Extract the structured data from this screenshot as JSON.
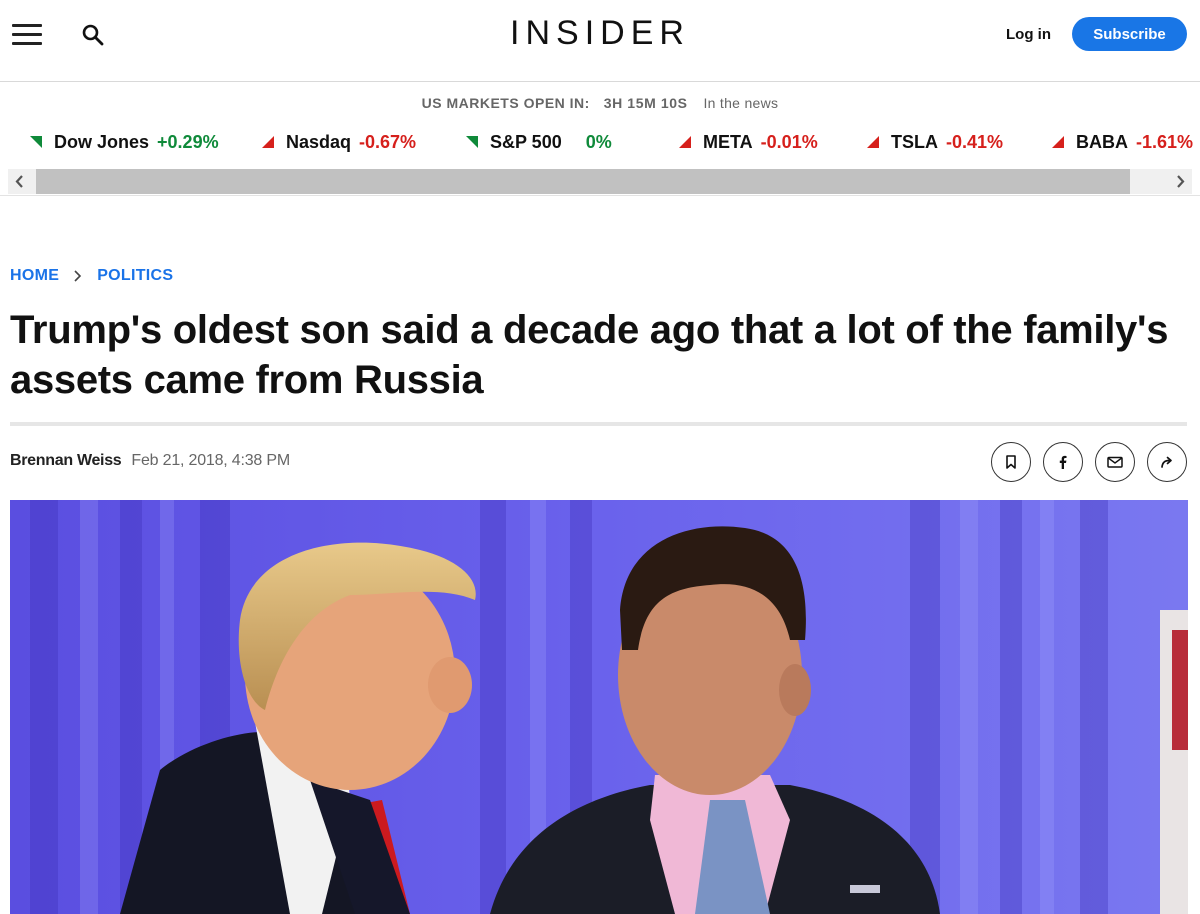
{
  "header": {
    "logo_text": "INSIDER",
    "login_label": "Log in",
    "subscribe_label": "Subscribe",
    "accent_color": "#1976e6"
  },
  "markets": {
    "status_label": "US MARKETS OPEN IN:",
    "countdown": "3H 15M 10S",
    "news_label": "In the news",
    "tickers": [
      {
        "name": "Dow Jones",
        "change": "+0.29%",
        "direction": "up-green"
      },
      {
        "name": "Nasdaq",
        "change": "-0.67%",
        "direction": "down-red"
      },
      {
        "name": "S&P 500",
        "change": "0%",
        "direction": "up-green"
      },
      {
        "name": "META",
        "change": "-0.01%",
        "direction": "down-red"
      },
      {
        "name": "TSLA",
        "change": "-0.41%",
        "direction": "down-red"
      },
      {
        "name": "BABA",
        "change": "-1.61%",
        "direction": "down-red"
      }
    ],
    "positive_color": "#0f8a3a",
    "negative_color": "#d6201c"
  },
  "breadcrumb": {
    "items": [
      "HOME",
      "POLITICS"
    ]
  },
  "article": {
    "title": "Trump's oldest son said a decade ago that a lot of the family's assets came from Russia",
    "author": "Brennan Weiss",
    "date": "Feb 21, 2018, 4:38 PM",
    "share_icons": [
      "bookmark-icon",
      "facebook-icon",
      "email-icon",
      "share-arrow-icon"
    ]
  }
}
